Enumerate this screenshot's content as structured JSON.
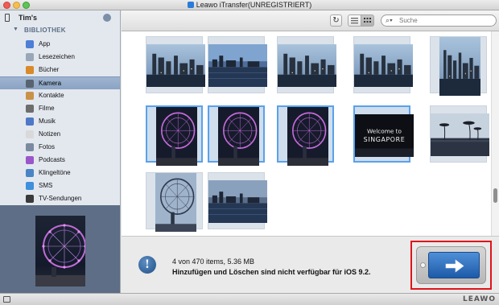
{
  "window": {
    "title": "Leawo iTransfer(UNREGISTRIERT)"
  },
  "sidebar": {
    "device": "Tim's",
    "section": "BIBLIOTHEK",
    "items": [
      {
        "label": "App",
        "icon": "app-store-icon",
        "color": "#4d7fd6"
      },
      {
        "label": "Lesezeichen",
        "icon": "bookmark-icon",
        "color": "#9aa7b8"
      },
      {
        "label": "Bücher",
        "icon": "book-icon",
        "color": "#d98a2b"
      },
      {
        "label": "Kamera",
        "icon": "camera-icon",
        "color": "#59636f",
        "active": true
      },
      {
        "label": "Kontakte",
        "icon": "contacts-icon",
        "color": "#c9924b"
      },
      {
        "label": "Filme",
        "icon": "film-icon",
        "color": "#6d6d6d"
      },
      {
        "label": "Musik",
        "icon": "music-icon",
        "color": "#4f78c6"
      },
      {
        "label": "Notizen",
        "icon": "notes-icon",
        "color": "#d9d9d9"
      },
      {
        "label": "Fotos",
        "icon": "photos-icon",
        "color": "#7b8aa0"
      },
      {
        "label": "Podcasts",
        "icon": "podcast-icon",
        "color": "#9b57c9"
      },
      {
        "label": "Klingeltöne",
        "icon": "ringtone-icon",
        "color": "#4b84c4"
      },
      {
        "label": "SMS",
        "icon": "message-icon",
        "color": "#3f8fdc"
      },
      {
        "label": "TV-Sendungen",
        "icon": "tv-icon",
        "color": "#3a3a3a"
      }
    ]
  },
  "toolbar": {
    "search_placeholder": "Suche"
  },
  "status": {
    "count": "4 von 470 items, 5.36 MB",
    "message": "Hinzufügen und Löschen sind nicht  verfügbar für iOS 9.2."
  },
  "footer": {
    "brand": "LEAWO"
  },
  "photos": [
    {
      "kind": "skyline",
      "selected": false
    },
    {
      "kind": "harbor",
      "selected": false
    },
    {
      "kind": "skyline",
      "selected": false
    },
    {
      "kind": "skyline",
      "selected": false
    },
    {
      "kind": "skyline-portrait",
      "selected": false
    },
    {
      "kind": "wheel",
      "selected": true
    },
    {
      "kind": "wheel",
      "selected": true
    },
    {
      "kind": "wheel",
      "selected": true
    },
    {
      "kind": "welcome-sign",
      "selected": true,
      "sign_line1": "Welcome to",
      "sign_line2": "SINGAPORE"
    },
    {
      "kind": "palms",
      "selected": false
    },
    {
      "kind": "wheel-dusk",
      "selected": false
    },
    {
      "kind": "harbor-dusk",
      "selected": false
    }
  ]
}
